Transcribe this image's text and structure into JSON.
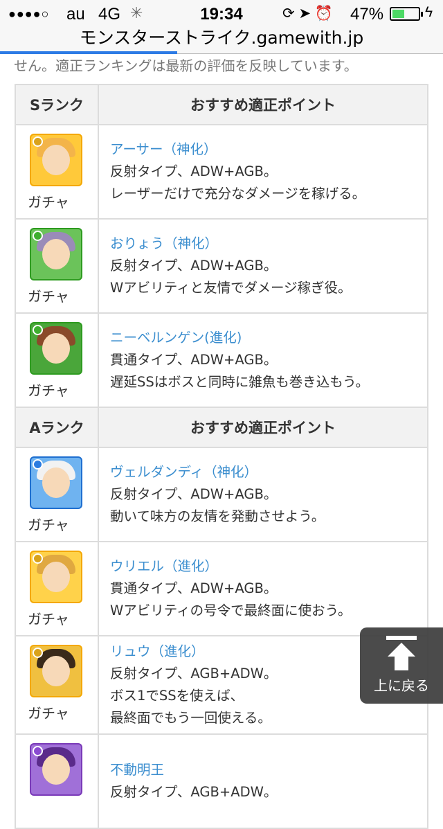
{
  "status_bar": {
    "signal": "●●●●○",
    "carrier": "au",
    "network": "4G",
    "time": "19:34",
    "battery_percent": "47%",
    "battery_level": 0.47
  },
  "browser": {
    "url": "モンスターストライク.gamewith.jp",
    "load_progress": 0.4
  },
  "intro_text": "せん。適正ランキングは最新の評価を反映しています。",
  "sections": [
    {
      "rank_label": "Sランク",
      "points_header": "おすすめ適正ポイント",
      "rows": [
        {
          "name": "アーサー（神化）",
          "lines": [
            "反射タイプ、ADW+AGB。",
            "レーザーだけで充分なダメージを稼げる。"
          ],
          "obtain": "ガチャ",
          "frame": "#f4a800",
          "bg": "#ffc93a",
          "hair": "#f3b44a",
          "element": "#d9a21b"
        },
        {
          "name": "おりょう（神化）",
          "lines": [
            "反射タイプ、ADW+AGB。",
            "Wアビリティと友情でダメージ稼ぎ役。"
          ],
          "obtain": "ガチャ",
          "frame": "#2e9b20",
          "bg": "#6bc35a",
          "hair": "#9a8bb8",
          "element": "#3fae2f"
        },
        {
          "name": "ニーベルンゲン(進化)",
          "lines": [
            "貫通タイプ、ADW+AGB。",
            "遅延SSはボスと同時に雑魚も巻き込もう。"
          ],
          "obtain": "ガチャ",
          "frame": "#2e9b20",
          "bg": "#4aa63a",
          "hair": "#8a4a2a",
          "element": "#3fae2f"
        }
      ]
    },
    {
      "rank_label": "Aランク",
      "points_header": "おすすめ適正ポイント",
      "rows": [
        {
          "name": "ヴェルダンディ（神化）",
          "lines": [
            "反射タイプ、ADW+AGB。",
            "動いて味方の友情を発動させよう。"
          ],
          "obtain": "ガチャ",
          "frame": "#1f6fd0",
          "bg": "#6fb3f0",
          "hair": "#f2f2f2",
          "element": "#2a7be0"
        },
        {
          "name": "ウリエル（進化）",
          "lines": [
            "貫通タイプ、ADW+AGB。",
            "Wアビリティの号令で最終面に使おう。"
          ],
          "obtain": "ガチャ",
          "frame": "#f4a800",
          "bg": "#ffd24a",
          "hair": "#e0a840",
          "element": "#d9a21b"
        },
        {
          "name": "リュウ（進化）",
          "lines": [
            "反射タイプ、AGB+ADW。",
            "ボス1でSSを使えば、",
            "最終面でもう一回使える。"
          ],
          "obtain": "ガチャ",
          "frame": "#f4a800",
          "bg": "#f0c040",
          "hair": "#3a2a1a",
          "element": "#d9a21b"
        },
        {
          "name": "不動明王",
          "lines": [
            "反射タイプ、AGB+ADW。"
          ],
          "obtain": "",
          "frame": "#7a3ab8",
          "bg": "#a070d8",
          "hair": "#5a2a8a",
          "element": "#8a4ad0"
        }
      ]
    }
  ],
  "back_to_top": {
    "label": "上に戻る"
  }
}
